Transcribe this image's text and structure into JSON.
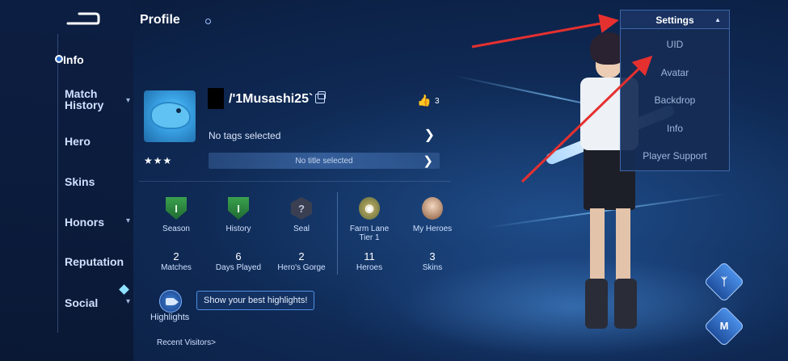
{
  "header": {
    "title": "Profile"
  },
  "sidebar": {
    "items": [
      {
        "label": "Info"
      },
      {
        "label": "Match\nHistory"
      },
      {
        "label": "Hero"
      },
      {
        "label": "Skins"
      },
      {
        "label": "Honors"
      },
      {
        "label": "Reputation"
      },
      {
        "label": "Social"
      }
    ]
  },
  "profile": {
    "name": "/'1Musashi25`",
    "likes": "3",
    "stars": "★★★",
    "tags_text": "No tags selected",
    "title_text": "No title selected"
  },
  "stats_left": [
    {
      "label": "Season",
      "value": "2",
      "sub": "Matches"
    },
    {
      "label": "History",
      "value": "6",
      "sub": "Days Played"
    },
    {
      "label": "Seal",
      "value": "2",
      "sub": "Hero's Gorge"
    }
  ],
  "stats_right": [
    {
      "label": "Farm Lane\nTier 1",
      "value": "11",
      "sub": "Heroes"
    },
    {
      "label": "My Heroes",
      "value": "3",
      "sub": "Skins"
    }
  ],
  "highlights": {
    "label": "Highlights",
    "tip": "Show your best highlights!"
  },
  "recent_visitors": "Recent Visitors>",
  "settings": {
    "label": "Settings",
    "items": [
      "UID",
      "Avatar",
      "Backdrop",
      "Info",
      "Player Support"
    ]
  },
  "colors": {
    "accent": "#3d66a8",
    "annotation_arrow": "#e53030"
  },
  "icons": {
    "season": "green-shield-icon",
    "history": "green-shield-icon",
    "seal": "hexagon-question-icon",
    "farm_lane": "lane-emblem-icon",
    "my_heroes": "hero-portrait-icon"
  }
}
